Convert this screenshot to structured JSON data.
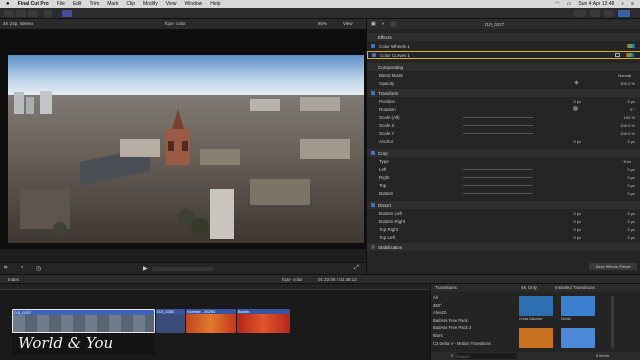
{
  "menubar": {
    "items": [
      "Final Cut Pro",
      "File",
      "Edit",
      "Trim",
      "Mark",
      "Clip",
      "Modify",
      "View",
      "Window",
      "Help"
    ],
    "datetime": "Sun 4 Apr 12:48"
  },
  "viewer": {
    "format": "4K 24p, Stereo",
    "project": "fcpx- color",
    "zoom": "50%",
    "view_label": "View"
  },
  "inspector": {
    "clip_name": "DJI_0227",
    "effects_header": "Effects",
    "effect_1": "Color Wheels 1",
    "effect_2": "Color Curves 1",
    "compositing": {
      "header": "Compositing",
      "blend_mode_label": "Blend Mode",
      "blend_mode_value": "Normal",
      "opacity_label": "Opacity",
      "opacity_value": "100.0 %"
    },
    "transform": {
      "header": "Transform",
      "position": {
        "label": "Position",
        "x": "0 px",
        "y": "0 px"
      },
      "rotation": {
        "label": "Rotation",
        "value": "0 °"
      },
      "scale_all": {
        "label": "Scale (All)",
        "value": "100 %"
      },
      "scale_x": {
        "label": "Scale X",
        "value": "100.0 %"
      },
      "scale_y": {
        "label": "Scale Y",
        "value": "100.0 %"
      },
      "anchor": {
        "label": "Anchor",
        "x": "0 px",
        "y": "0 px"
      }
    },
    "crop": {
      "header": "Crop",
      "type_label": "Type",
      "type_value": "Trim",
      "left": {
        "label": "Left",
        "value": "0 px"
      },
      "right": {
        "label": "Right",
        "value": "0 px"
      },
      "top": {
        "label": "Top",
        "value": "0 px"
      },
      "bottom": {
        "label": "Bottom",
        "value": "0 px"
      }
    },
    "distort": {
      "header": "Distort",
      "bottom_left": {
        "label": "Bottom Left",
        "x": "0 px",
        "y": "0 px"
      },
      "bottom_right": {
        "label": "Bottom Right",
        "x": "0 px",
        "y": "0 px"
      },
      "top_right": {
        "label": "Top Right",
        "x": "0 px",
        "y": "0 px"
      },
      "top_left": {
        "label": "Top Left",
        "x": "0 px",
        "y": "0 px"
      }
    },
    "stabilization_header": "Stabilization",
    "save_preset": "Save Effects Preset"
  },
  "timeline": {
    "index_label": "Index",
    "project": "fcpx- color",
    "timecode": "01:22:06 / 02:38:12",
    "clips": [
      {
        "name": "DJI_0227",
        "color": "#3f63b8"
      },
      {
        "name": "DJI_0282",
        "color": "#3a55a0"
      },
      {
        "name": "Sunrise - 36294",
        "color": "#3a55a0"
      },
      {
        "name": "Bokeh",
        "color": "#3a55a0"
      }
    ],
    "title_overlay": "World & You"
  },
  "transitions": {
    "header": "Transitions",
    "filter_4k": "4K Only",
    "installed_label": "Installed Transitions",
    "categories": [
      "All",
      "360°",
      "Alex4D",
      "BadAss Free Pack",
      "BadAss Free Pack 3",
      "Blurs",
      "C3 Delta V - Motion Transitions"
    ],
    "thumbs": [
      {
        "label": "Cross Dissolve",
        "color": "#2d6fb0"
      },
      {
        "label": "Divide",
        "color": "#3b7fcf"
      },
      {
        "label": "",
        "color": "#c8711e"
      },
      {
        "label": "",
        "color": "#4c8ad9"
      }
    ],
    "search_placeholder": "Search",
    "count": "6 items"
  }
}
